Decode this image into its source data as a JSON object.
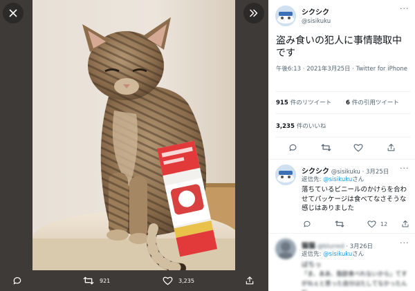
{
  "viewer": {
    "actions": {
      "reply_count": "",
      "retweet_count": "921",
      "like_count": "3,235",
      "share_count": ""
    }
  },
  "tweet": {
    "display_name": "シクシク",
    "handle": "@sisikuku",
    "text": "盗み食いの犯人に事情聴取中です",
    "timestamp": "午後6:13 · 2021年3月25日",
    "source": "Twitter for iPhone",
    "retweets_value": "915",
    "retweets_label": "件のリツイート",
    "quotes_value": "6",
    "quotes_label": "件の引用ツイート",
    "likes_value": "3,235",
    "likes_label": "件のいいね"
  },
  "replies": [
    {
      "display_name": "シクシク",
      "handle": "@sisikuku",
      "date": "3月25日",
      "reply_to_prefix": "返信先:",
      "reply_to_handle": "@sisikuku",
      "reply_to_suffix": "さん",
      "text": "落ちているビニールのかけらを合わせてパッケージは食べてなさそうな感じはありました",
      "reply_count": "",
      "retweet_count": "",
      "like_count": "12"
    },
    {
      "display_name": "猫猫",
      "handle": "@blurred",
      "date": "3月26日",
      "reply_to_prefix": "返信先:",
      "reply_to_handle": "@sisikuku",
      "reply_to_suffix": "さん",
      "text": "ばちっ",
      "text2": "「ま、ああ、脂肪食べれないから」てすがねぇと思った自分はたしてなかったんだ"
    }
  ],
  "colors": {
    "viewer_bg": "#3d3a38",
    "link": "#1d9bf0",
    "text_primary": "#0f1419",
    "text_secondary": "#536471"
  },
  "icons": {
    "close": "close-icon",
    "expand": "expand-icon",
    "reply": "reply-icon",
    "retweet": "retweet-icon",
    "like": "heart-icon",
    "share": "share-icon",
    "more": "more-icon"
  }
}
